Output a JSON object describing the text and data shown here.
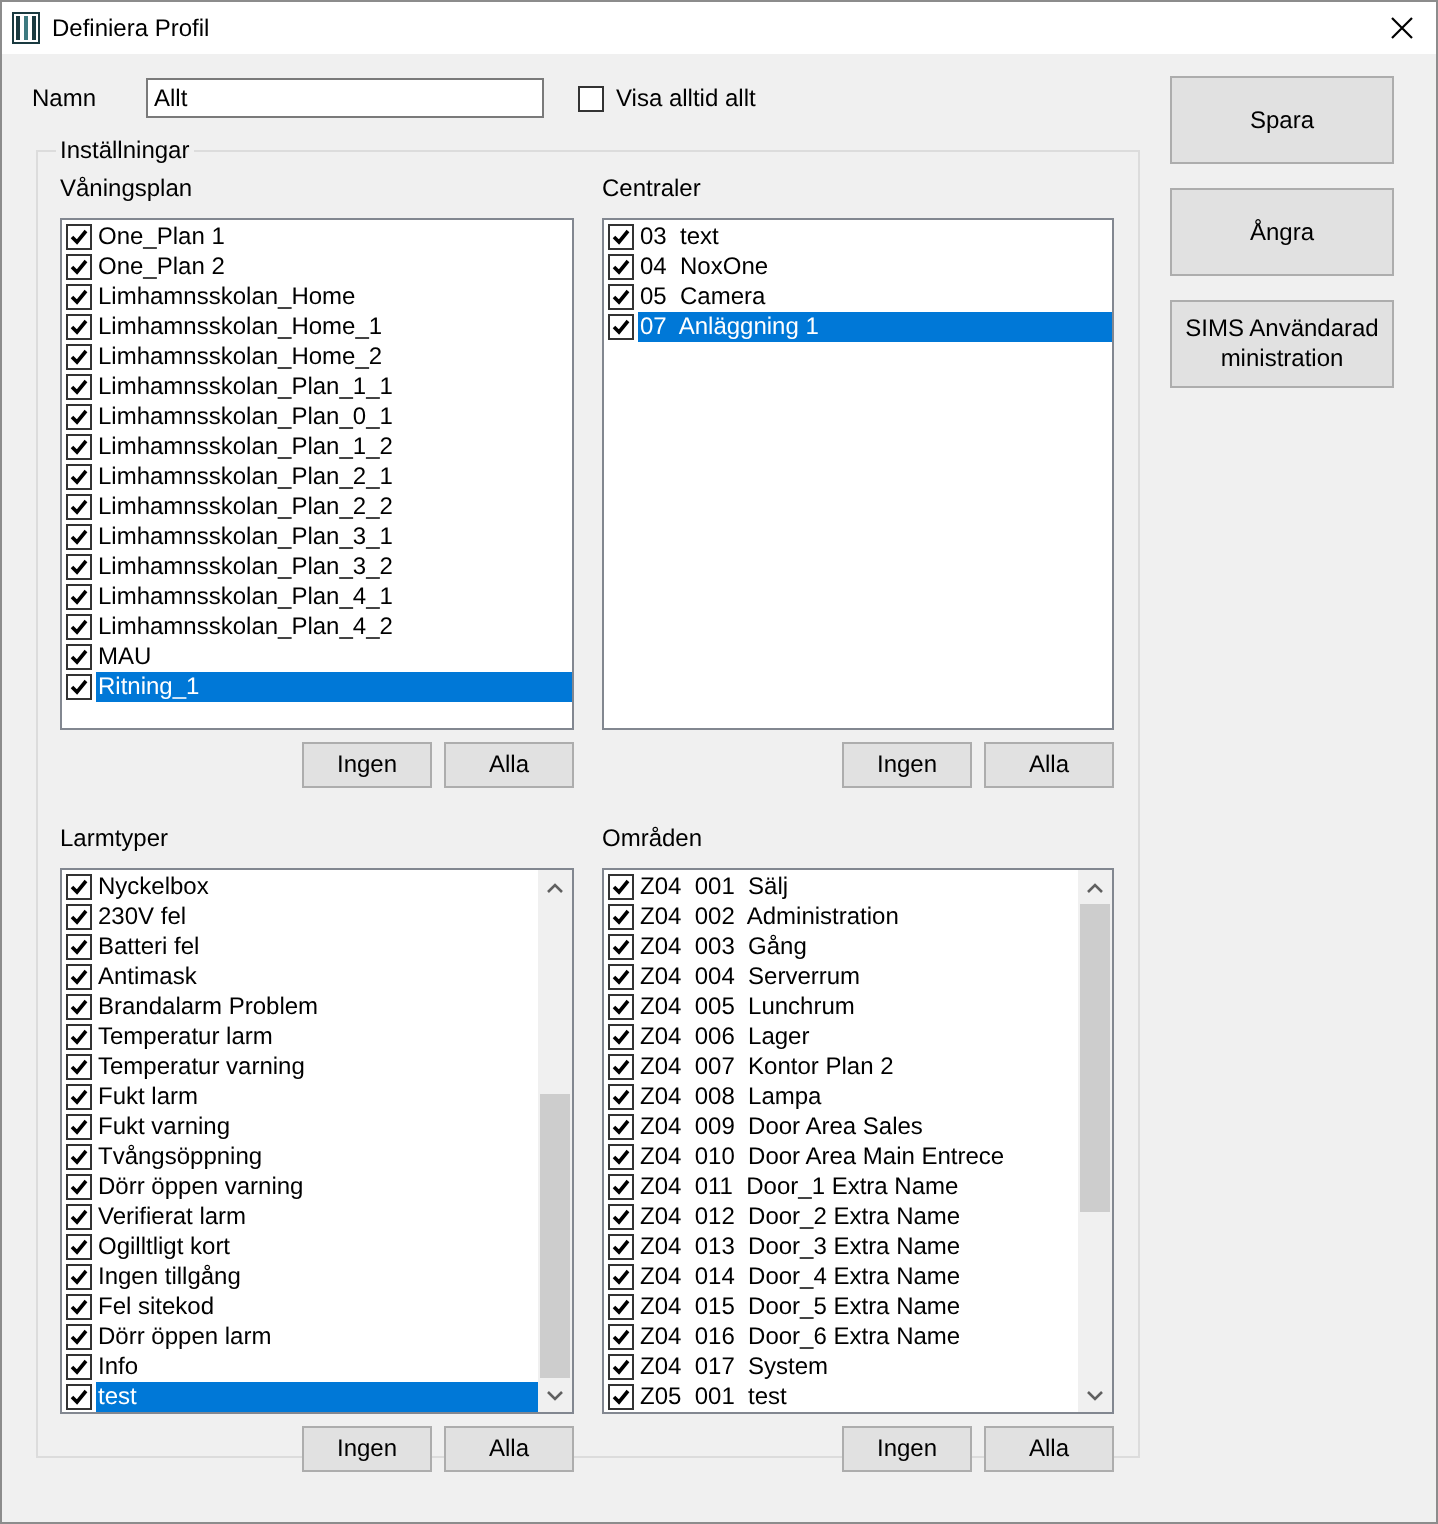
{
  "window": {
    "title": "Definiera Profil"
  },
  "name_field": {
    "label": "Namn",
    "value": "Allt"
  },
  "always_show_all": {
    "label": "Visa alltid allt",
    "checked": false
  },
  "settings": {
    "title": "Inställningar",
    "lists": [
      {
        "title": "Våningsplan",
        "buttons": [
          "Ingen",
          "Alla"
        ],
        "items": [
          {
            "label": "One_Plan 1",
            "checked": true,
            "selected": false
          },
          {
            "label": "One_Plan 2",
            "checked": true,
            "selected": false
          },
          {
            "label": "Limhamnsskolan_Home",
            "checked": true,
            "selected": false
          },
          {
            "label": "Limhamnsskolan_Home_1",
            "checked": true,
            "selected": false
          },
          {
            "label": "Limhamnsskolan_Home_2",
            "checked": true,
            "selected": false
          },
          {
            "label": "Limhamnsskolan_Plan_1_1",
            "checked": true,
            "selected": false
          },
          {
            "label": "Limhamnsskolan_Plan_0_1",
            "checked": true,
            "selected": false
          },
          {
            "label": "Limhamnsskolan_Plan_1_2",
            "checked": true,
            "selected": false
          },
          {
            "label": "Limhamnsskolan_Plan_2_1",
            "checked": true,
            "selected": false
          },
          {
            "label": "Limhamnsskolan_Plan_2_2",
            "checked": true,
            "selected": false
          },
          {
            "label": "Limhamnsskolan_Plan_3_1",
            "checked": true,
            "selected": false
          },
          {
            "label": "Limhamnsskolan_Plan_3_2",
            "checked": true,
            "selected": false
          },
          {
            "label": "Limhamnsskolan_Plan_4_1",
            "checked": true,
            "selected": false
          },
          {
            "label": "Limhamnsskolan_Plan_4_2",
            "checked": true,
            "selected": false
          },
          {
            "label": "MAU",
            "checked": true,
            "selected": false
          },
          {
            "label": "Ritning_1",
            "checked": true,
            "selected": true
          }
        ]
      },
      {
        "title": "Centraler",
        "buttons": [
          "Ingen",
          "Alla"
        ],
        "items": [
          {
            "label": "03  text",
            "checked": true,
            "selected": false
          },
          {
            "label": "04  NoxOne",
            "checked": true,
            "selected": false
          },
          {
            "label": "05  Camera",
            "checked": true,
            "selected": false
          },
          {
            "label": "07  Anläggning 1",
            "checked": true,
            "selected": true
          }
        ]
      },
      {
        "title": "Larmtyper",
        "buttons": [
          "Ingen",
          "Alla"
        ],
        "items": [
          {
            "label": "Nyckelbox",
            "checked": true,
            "selected": false
          },
          {
            "label": "230V fel",
            "checked": true,
            "selected": false
          },
          {
            "label": "Batteri fel",
            "checked": true,
            "selected": false
          },
          {
            "label": "Antimask",
            "checked": true,
            "selected": false
          },
          {
            "label": "Brandalarm Problem",
            "checked": true,
            "selected": false
          },
          {
            "label": "Temperatur larm",
            "checked": true,
            "selected": false
          },
          {
            "label": "Temperatur varning",
            "checked": true,
            "selected": false
          },
          {
            "label": "Fukt larm",
            "checked": true,
            "selected": false
          },
          {
            "label": "Fukt varning",
            "checked": true,
            "selected": false
          },
          {
            "label": "Tvångsöppning",
            "checked": true,
            "selected": false
          },
          {
            "label": "Dörr öppen varning",
            "checked": true,
            "selected": false
          },
          {
            "label": "Verifierat larm",
            "checked": true,
            "selected": false
          },
          {
            "label": "Ogilltligt kort",
            "checked": true,
            "selected": false
          },
          {
            "label": "Ingen tillgång",
            "checked": true,
            "selected": false
          },
          {
            "label": "Fel sitekod",
            "checked": true,
            "selected": false
          },
          {
            "label": "Dörr öppen larm",
            "checked": true,
            "selected": false
          },
          {
            "label": "Info",
            "checked": true,
            "selected": false
          },
          {
            "label": "test",
            "checked": true,
            "selected": true
          }
        ]
      },
      {
        "title": "Områden",
        "buttons": [
          "Ingen",
          "Alla"
        ],
        "items": [
          {
            "label": "Z04  001  Sälj",
            "checked": true,
            "selected": false
          },
          {
            "label": "Z04  002  Administration",
            "checked": true,
            "selected": false
          },
          {
            "label": "Z04  003  Gång",
            "checked": true,
            "selected": false
          },
          {
            "label": "Z04  004  Serverrum",
            "checked": true,
            "selected": false
          },
          {
            "label": "Z04  005  Lunchrum",
            "checked": true,
            "selected": false
          },
          {
            "label": "Z04  006  Lager",
            "checked": true,
            "selected": false
          },
          {
            "label": "Z04  007  Kontor Plan 2",
            "checked": true,
            "selected": false
          },
          {
            "label": "Z04  008  Lampa",
            "checked": true,
            "selected": false
          },
          {
            "label": "Z04  009  Door Area Sales",
            "checked": true,
            "selected": false
          },
          {
            "label": "Z04  010  Door Area Main Entrece",
            "checked": true,
            "selected": false
          },
          {
            "label": "Z04  011  Door_1 Extra Name",
            "checked": true,
            "selected": false
          },
          {
            "label": "Z04  012  Door_2 Extra Name",
            "checked": true,
            "selected": false
          },
          {
            "label": "Z04  013  Door_3 Extra Name",
            "checked": true,
            "selected": false
          },
          {
            "label": "Z04  014  Door_4 Extra Name",
            "checked": true,
            "selected": false
          },
          {
            "label": "Z04  015  Door_5 Extra Name",
            "checked": true,
            "selected": false
          },
          {
            "label": "Z04  016  Door_6 Extra Name",
            "checked": true,
            "selected": false
          },
          {
            "label": "Z04  017  System",
            "checked": true,
            "selected": false
          },
          {
            "label": "Z05  001  test",
            "checked": true,
            "selected": false
          }
        ]
      }
    ]
  },
  "actions": [
    "Spara",
    "Ångra",
    "SIMS Användaradministration"
  ]
}
